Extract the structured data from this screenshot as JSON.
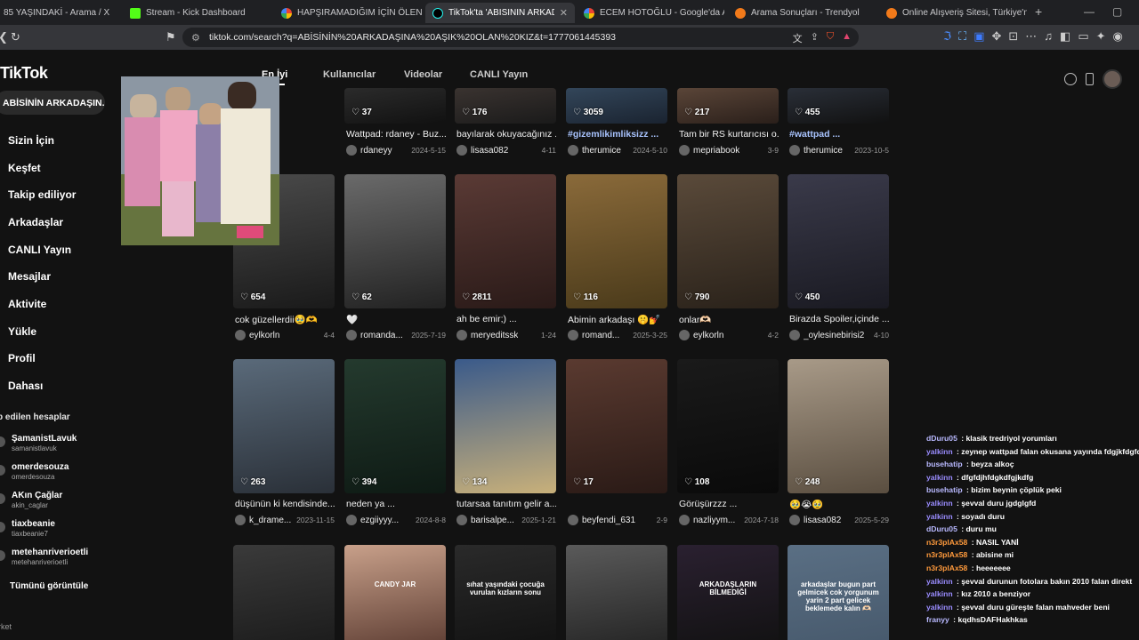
{
  "browser": {
    "tabs": [
      {
        "label": "85 YAŞINDAKİ - Arama / X",
        "fav": "x-icon"
      },
      {
        "label": "Stream - Kick Dashboard",
        "fav": "kick-icon"
      },
      {
        "label": "HAPŞIRAMADIĞIM İÇİN ÖLEN KADI",
        "fav": "google-icon"
      },
      {
        "label": "TikTok'ta 'ABİSİNİN ARKADAŞIN",
        "fav": "tiktok-icon",
        "active": true
      },
      {
        "label": "ECEM HOTOĞLU - Google'da Ara",
        "fav": "google-icon"
      },
      {
        "label": "Arama Sonuçları - Trendyol",
        "fav": "trendyol-icon"
      },
      {
        "label": "Online Alışveriş Sitesi, Türkiye'nin Te",
        "fav": "trendyol-icon"
      }
    ],
    "url": "tiktok.com/search?q=ABİSİNİN%20ARKADAŞINA%20AŞIK%20OLAN%20KIZ&t=1777061445393",
    "new_tab": "+"
  },
  "sidebar": {
    "logo": "TikTok",
    "search_query": "ABİSİNİN ARKADAŞIN...",
    "nav": [
      {
        "label": "Sizin İçin",
        "icon": "home-icon"
      },
      {
        "label": "Keşfet",
        "icon": "compass-icon"
      },
      {
        "label": "Takip ediliyor",
        "icon": "following-icon"
      },
      {
        "label": "Arkadaşlar",
        "icon": "friends-icon"
      },
      {
        "label": "CANLI Yayın",
        "icon": "live-icon"
      },
      {
        "label": "Mesajlar",
        "icon": "messages-icon"
      },
      {
        "label": "Aktivite",
        "icon": "activity-icon"
      },
      {
        "label": "Yükle",
        "icon": "upload-icon"
      },
      {
        "label": "Profil",
        "icon": "profile-icon"
      },
      {
        "label": "Dahası",
        "icon": "more-icon"
      }
    ],
    "following_title": "p edilen hesaplar",
    "accounts": [
      {
        "name": "ŞamanistLavuk",
        "handle": "samanistlavuk"
      },
      {
        "name": "omerdesouza",
        "handle": "omerdesouza"
      },
      {
        "name": "AKın Çağlar",
        "handle": "akin_caglar"
      },
      {
        "name": "tiaxbeanie",
        "handle": "tiaxbeanie7"
      },
      {
        "name": "metehanriverioetli",
        "handle": "metehanriverioetli"
      }
    ],
    "see_all": "Tümünü görüntüle",
    "footer": "rket"
  },
  "search_tabs": [
    "En İyi",
    "Kullanıcılar",
    "Videolar",
    "CANLI Yayın"
  ],
  "videos": [
    {
      "likes": "37",
      "caption": "Wattpad: rdaney - Buz...",
      "user": "rdaneyy",
      "date": "2024-5-15"
    },
    {
      "likes": "176",
      "caption": "bayılarak okuyacağınız ...",
      "user": "lisasa082",
      "date": "4-11"
    },
    {
      "likes": "3059",
      "caption": "#gizemlikimliksizz ...",
      "user": "therumice",
      "date": "2024-5-10",
      "tag": true
    },
    {
      "likes": "217",
      "caption": "Tam bir RS kurtarıcısı o...",
      "user": "mepriabook",
      "date": "3-9"
    },
    {
      "likes": "455",
      "caption": "#wattpad ...",
      "user": "therumice",
      "date": "2023-10-5",
      "tag": true
    },
    {
      "likes": "654",
      "caption": "cok güzellerdii🥹🫶",
      "user": "eylkorln",
      "date": "4-4"
    },
    {
      "likes": "62",
      "caption": "🤍",
      "user": "romanda...",
      "date": "2025-7-19"
    },
    {
      "likes": "2811",
      "caption": "ah be emir;) ...",
      "user": "meryeditssk",
      "date": "1-24"
    },
    {
      "likes": "116",
      "caption": "Abimin arkadaşı 🤫💅",
      "user": "romand...",
      "date": "2025-3-25"
    },
    {
      "likes": "790",
      "caption": "onlar🫶🏻",
      "user": "eylkorln",
      "date": "4-2"
    },
    {
      "likes": "450",
      "caption": "Birazda Spoiler,içinde ...",
      "user": "_oylesinebirisi2",
      "date": "4-10"
    },
    {
      "likes": "263",
      "caption": "düşünün ki kendisinde...",
      "user": "k_drame...",
      "date": "2023-11-15"
    },
    {
      "likes": "394",
      "caption": "neden ya ...",
      "user": "ezgiiyyy...",
      "date": "2024-8-8"
    },
    {
      "likes": "134",
      "caption": "tutarsaa tanıtım gelir a...",
      "user": "barisalpe...",
      "date": "2025-1-21"
    },
    {
      "likes": "17",
      "caption": "",
      "user": "beyfendi_631",
      "date": "2-9"
    },
    {
      "likes": "108",
      "caption": "Görüşürzzz ...",
      "user": "nazliyym...",
      "date": "2024-7-18"
    },
    {
      "likes": "248",
      "caption": "🥹😭🥹",
      "user": "lisasa082",
      "date": "2025-5-29"
    },
    {
      "overlay": ""
    },
    {
      "overlay": "CANDY JAR"
    },
    {
      "overlay": "sıhat yaşındaki çocuğa vurulan kızların sonu"
    },
    {
      "overlay": ""
    },
    {
      "overlay": "ARKADAŞLARIN BİLMEDİĞİ"
    },
    {
      "overlay": "arkadaşlar bugun part gelmicek cok yorgunum yarin 2 part gelicek beklemede kalın 🫶🏻"
    }
  ],
  "chat": [
    {
      "user": "dDuru05",
      "color": "#b9b9ff",
      "msg": "klasik tredriyol yorumları"
    },
    {
      "user": "yalkinn",
      "color": "#9a8cff",
      "msg": "zeynep wattpad falan okusana yayında fdgjkfdgfd"
    },
    {
      "user": "busehatip",
      "color": "#b9b9ff",
      "msg": "beyza alkoç"
    },
    {
      "user": "yalkinn",
      "color": "#9a8cff",
      "msg": "dfgfdjhfdgkdfgjkdfg"
    },
    {
      "user": "busehatip",
      "color": "#b9b9ff",
      "msg": "bizim beynin çöplük peki"
    },
    {
      "user": "yalkinn",
      "color": "#9a8cff",
      "msg": "şevval duru jgdglgfd"
    },
    {
      "user": "yalkinn",
      "color": "#9a8cff",
      "msg": "soyadı duru"
    },
    {
      "user": "dDuru05",
      "color": "#b9b9ff",
      "msg": "duru mu"
    },
    {
      "user": "n3r3plAx58",
      "color": "#ff9a3c",
      "msg": "NASIL YANİ"
    },
    {
      "user": "n3r3plAx58",
      "color": "#ff9a3c",
      "msg": "abisine mi"
    },
    {
      "user": "n3r3plAx58",
      "color": "#ff9a3c",
      "msg": "heeeeeee"
    },
    {
      "user": "yalkinn",
      "color": "#9a8cff",
      "msg": "şevval durunun fotolara bakın 2010 falan direkt"
    },
    {
      "user": "yalkinn",
      "color": "#9a8cff",
      "msg": "kız 2010 a benziyor"
    },
    {
      "user": "yalkinn",
      "color": "#9a8cff",
      "msg": "şevval duru güreşte falan mahveder beni"
    },
    {
      "user": "franyy",
      "color": "#b9b9ff",
      "msg": "kqdhsDAFHakhkas"
    }
  ]
}
